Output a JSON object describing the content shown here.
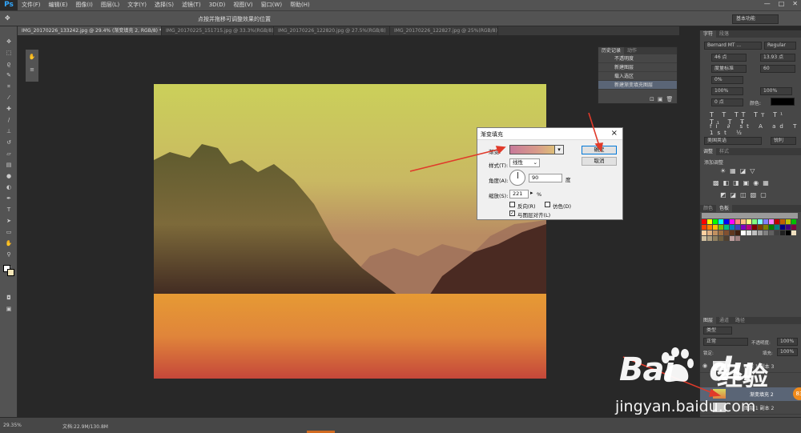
{
  "app": {
    "logo": "Ps",
    "menu": [
      "文件(F)",
      "编辑(E)",
      "图像(I)",
      "图层(L)",
      "文字(Y)",
      "选择(S)",
      "滤镜(T)",
      "3D(D)",
      "视图(V)",
      "窗口(W)",
      "帮助(H)"
    ],
    "window_controls": [
      "—",
      "□",
      "✕"
    ],
    "options_hint": "点按并拖移可调整效果的位置",
    "workspace": "基本功能"
  },
  "tabs": [
    {
      "label": "IMG_20170226_133242.jpg @ 29.4% (渐变填充 2, RGB/8) *",
      "active": true
    },
    {
      "label": "IMG_20170225_151715.jpg @ 33.3%(RGB/8)",
      "active": false
    },
    {
      "label": "IMG_20170226_122820.jpg @ 27.5%(RGB/8)",
      "active": false
    },
    {
      "label": "IMG_20170226_122827.jpg @ 25%(RGB/8) *",
      "active": false
    }
  ],
  "history": {
    "tabs": [
      "历史记录",
      "动作"
    ],
    "items": [
      {
        "label": "不透明度",
        "active": false
      },
      {
        "label": "新建图层",
        "active": false
      },
      {
        "label": "载入选区",
        "active": false
      },
      {
        "label": "新建渐变填充图层",
        "active": true
      }
    ]
  },
  "character_panel": {
    "tabs": [
      "字符",
      "段落"
    ],
    "font_family": "Bernard MT ...",
    "font_style": "Regular",
    "font_size": "46 点",
    "leading": "13.93 点",
    "kerning": "度量标准",
    "tracking": "60",
    "scale_v": "0%",
    "scale_v2": "100%",
    "scale_h": "100%",
    "baseline": "0 点",
    "color_label": "颜色:",
    "language": "美国英语",
    "aa": "锐利"
  },
  "adjustments": {
    "tabs": [
      "调整",
      "样式"
    ],
    "title": "添加调整"
  },
  "swatch_panel": {
    "tabs": [
      "颜色",
      "色板"
    ]
  },
  "layers": {
    "tabs": [
      "图层",
      "通道",
      "路径"
    ],
    "filter": "类型",
    "blend_mode": "正常",
    "opacity_label": "不透明度:",
    "opacity": "100%",
    "lock_label": "锁定:",
    "fill_label": "填充:",
    "fill": "100%",
    "items": [
      {
        "name": "图层 1 副本 3"
      },
      {
        "name": "渐变填充 2"
      },
      {
        "name": "图层 1 副本 2"
      }
    ]
  },
  "status": {
    "zoom": "29.35%",
    "doc": "文档:22.9M/130.8M"
  },
  "dialog": {
    "title": "渐变填充",
    "gradient_label": "渐变:",
    "style_label": "样式(T):",
    "style_value": "线性",
    "angle_label": "角度(A):",
    "angle_value": "90",
    "angle_unit": "度",
    "scale_label": "缩放(S):",
    "scale_value": "221",
    "scale_unit": "%",
    "reverse_label": "反向(R)",
    "dither_label": "仿色(D)",
    "align_label": "与图层对齐(L)",
    "ok": "确定",
    "cancel": "取消"
  },
  "watermark": {
    "bai": "Bai",
    "du": "du",
    "cn": "经验",
    "url": "jingyan.baidu.com"
  },
  "badge": "83"
}
